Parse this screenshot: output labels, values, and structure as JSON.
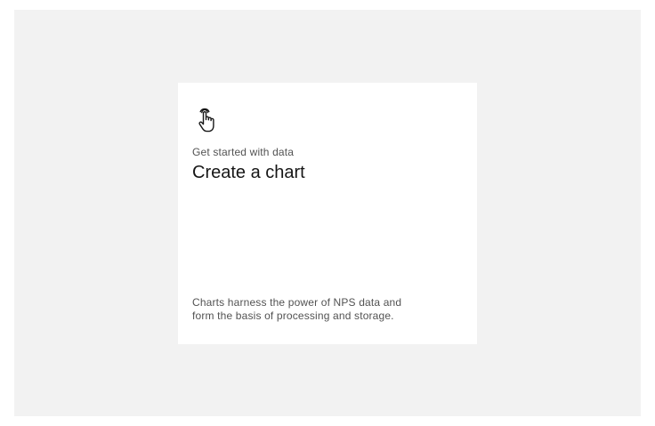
{
  "tile": {
    "icon": "touch-pointer-icon",
    "eyebrow": "Get started with data",
    "title": "Create a chart",
    "description_lines": [
      "Charts harness the power of NPS data and",
      "form the basis of processing and storage."
    ]
  },
  "colors": {
    "background": "#f2f2f2",
    "tile": "#ffffff",
    "title_text": "#161616",
    "secondary_text": "#525252"
  }
}
